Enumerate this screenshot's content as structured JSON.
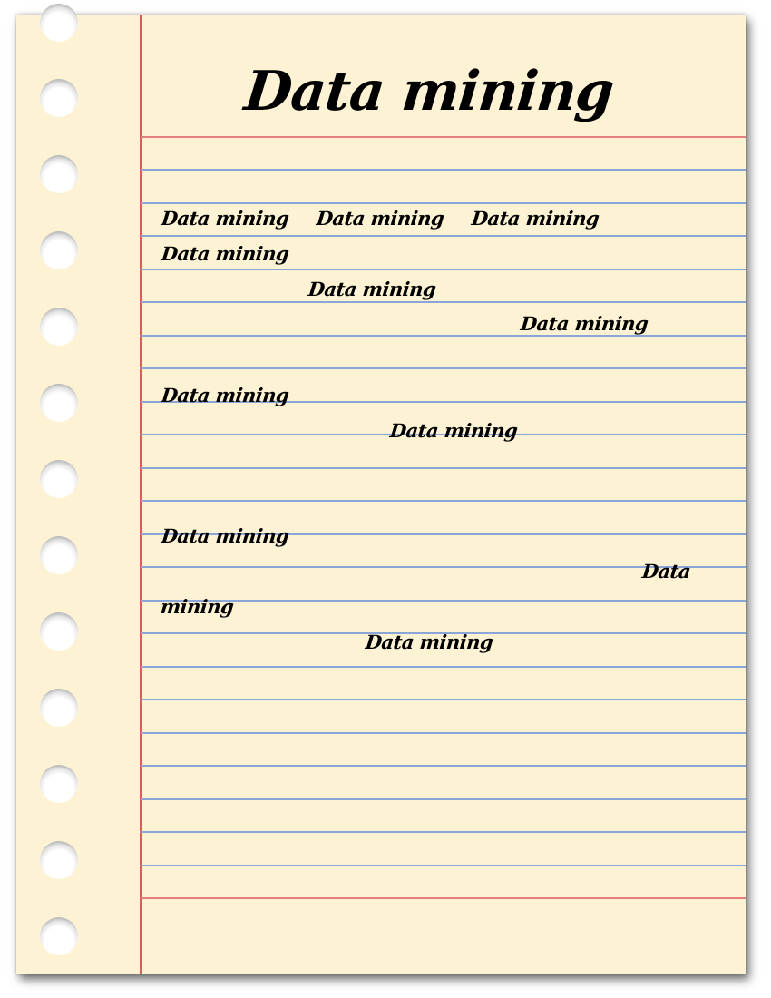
{
  "page": {
    "title": "Data mining",
    "notes": [
      "Data mining",
      "Data mining",
      "Data mining",
      "Data mining",
      "Data mining",
      "Data mining",
      "Data mining",
      "Data mining",
      "Data mining",
      "Data",
      "mining",
      "Data mining"
    ]
  },
  "colors": {
    "paper": "#fdf3d4",
    "margin_line": "#e15a5a",
    "ruled_line": "#8aa6d8",
    "ink": "#000000"
  },
  "icons": {
    "hole": "binder-hole-icon"
  }
}
